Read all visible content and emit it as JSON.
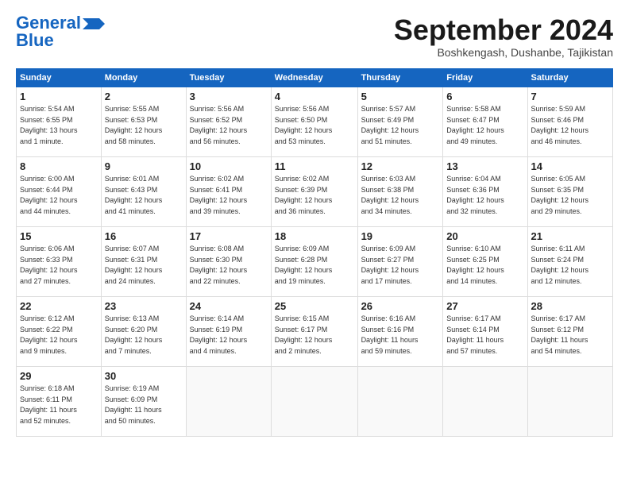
{
  "header": {
    "logo_line1": "General",
    "logo_line2": "Blue",
    "month": "September 2024",
    "location": "Boshkengash, Dushanbe, Tajikistan"
  },
  "days_of_week": [
    "Sunday",
    "Monday",
    "Tuesday",
    "Wednesday",
    "Thursday",
    "Friday",
    "Saturday"
  ],
  "weeks": [
    [
      {
        "day": 1,
        "info": "Sunrise: 5:54 AM\nSunset: 6:55 PM\nDaylight: 13 hours\nand 1 minute."
      },
      {
        "day": 2,
        "info": "Sunrise: 5:55 AM\nSunset: 6:53 PM\nDaylight: 12 hours\nand 58 minutes."
      },
      {
        "day": 3,
        "info": "Sunrise: 5:56 AM\nSunset: 6:52 PM\nDaylight: 12 hours\nand 56 minutes."
      },
      {
        "day": 4,
        "info": "Sunrise: 5:56 AM\nSunset: 6:50 PM\nDaylight: 12 hours\nand 53 minutes."
      },
      {
        "day": 5,
        "info": "Sunrise: 5:57 AM\nSunset: 6:49 PM\nDaylight: 12 hours\nand 51 minutes."
      },
      {
        "day": 6,
        "info": "Sunrise: 5:58 AM\nSunset: 6:47 PM\nDaylight: 12 hours\nand 49 minutes."
      },
      {
        "day": 7,
        "info": "Sunrise: 5:59 AM\nSunset: 6:46 PM\nDaylight: 12 hours\nand 46 minutes."
      }
    ],
    [
      {
        "day": 8,
        "info": "Sunrise: 6:00 AM\nSunset: 6:44 PM\nDaylight: 12 hours\nand 44 minutes."
      },
      {
        "day": 9,
        "info": "Sunrise: 6:01 AM\nSunset: 6:43 PM\nDaylight: 12 hours\nand 41 minutes."
      },
      {
        "day": 10,
        "info": "Sunrise: 6:02 AM\nSunset: 6:41 PM\nDaylight: 12 hours\nand 39 minutes."
      },
      {
        "day": 11,
        "info": "Sunrise: 6:02 AM\nSunset: 6:39 PM\nDaylight: 12 hours\nand 36 minutes."
      },
      {
        "day": 12,
        "info": "Sunrise: 6:03 AM\nSunset: 6:38 PM\nDaylight: 12 hours\nand 34 minutes."
      },
      {
        "day": 13,
        "info": "Sunrise: 6:04 AM\nSunset: 6:36 PM\nDaylight: 12 hours\nand 32 minutes."
      },
      {
        "day": 14,
        "info": "Sunrise: 6:05 AM\nSunset: 6:35 PM\nDaylight: 12 hours\nand 29 minutes."
      }
    ],
    [
      {
        "day": 15,
        "info": "Sunrise: 6:06 AM\nSunset: 6:33 PM\nDaylight: 12 hours\nand 27 minutes."
      },
      {
        "day": 16,
        "info": "Sunrise: 6:07 AM\nSunset: 6:31 PM\nDaylight: 12 hours\nand 24 minutes."
      },
      {
        "day": 17,
        "info": "Sunrise: 6:08 AM\nSunset: 6:30 PM\nDaylight: 12 hours\nand 22 minutes."
      },
      {
        "day": 18,
        "info": "Sunrise: 6:09 AM\nSunset: 6:28 PM\nDaylight: 12 hours\nand 19 minutes."
      },
      {
        "day": 19,
        "info": "Sunrise: 6:09 AM\nSunset: 6:27 PM\nDaylight: 12 hours\nand 17 minutes."
      },
      {
        "day": 20,
        "info": "Sunrise: 6:10 AM\nSunset: 6:25 PM\nDaylight: 12 hours\nand 14 minutes."
      },
      {
        "day": 21,
        "info": "Sunrise: 6:11 AM\nSunset: 6:24 PM\nDaylight: 12 hours\nand 12 minutes."
      }
    ],
    [
      {
        "day": 22,
        "info": "Sunrise: 6:12 AM\nSunset: 6:22 PM\nDaylight: 12 hours\nand 9 minutes."
      },
      {
        "day": 23,
        "info": "Sunrise: 6:13 AM\nSunset: 6:20 PM\nDaylight: 12 hours\nand 7 minutes."
      },
      {
        "day": 24,
        "info": "Sunrise: 6:14 AM\nSunset: 6:19 PM\nDaylight: 12 hours\nand 4 minutes."
      },
      {
        "day": 25,
        "info": "Sunrise: 6:15 AM\nSunset: 6:17 PM\nDaylight: 12 hours\nand 2 minutes."
      },
      {
        "day": 26,
        "info": "Sunrise: 6:16 AM\nSunset: 6:16 PM\nDaylight: 11 hours\nand 59 minutes."
      },
      {
        "day": 27,
        "info": "Sunrise: 6:17 AM\nSunset: 6:14 PM\nDaylight: 11 hours\nand 57 minutes."
      },
      {
        "day": 28,
        "info": "Sunrise: 6:17 AM\nSunset: 6:12 PM\nDaylight: 11 hours\nand 54 minutes."
      }
    ],
    [
      {
        "day": 29,
        "info": "Sunrise: 6:18 AM\nSunset: 6:11 PM\nDaylight: 11 hours\nand 52 minutes."
      },
      {
        "day": 30,
        "info": "Sunrise: 6:19 AM\nSunset: 6:09 PM\nDaylight: 11 hours\nand 50 minutes."
      },
      null,
      null,
      null,
      null,
      null
    ]
  ]
}
